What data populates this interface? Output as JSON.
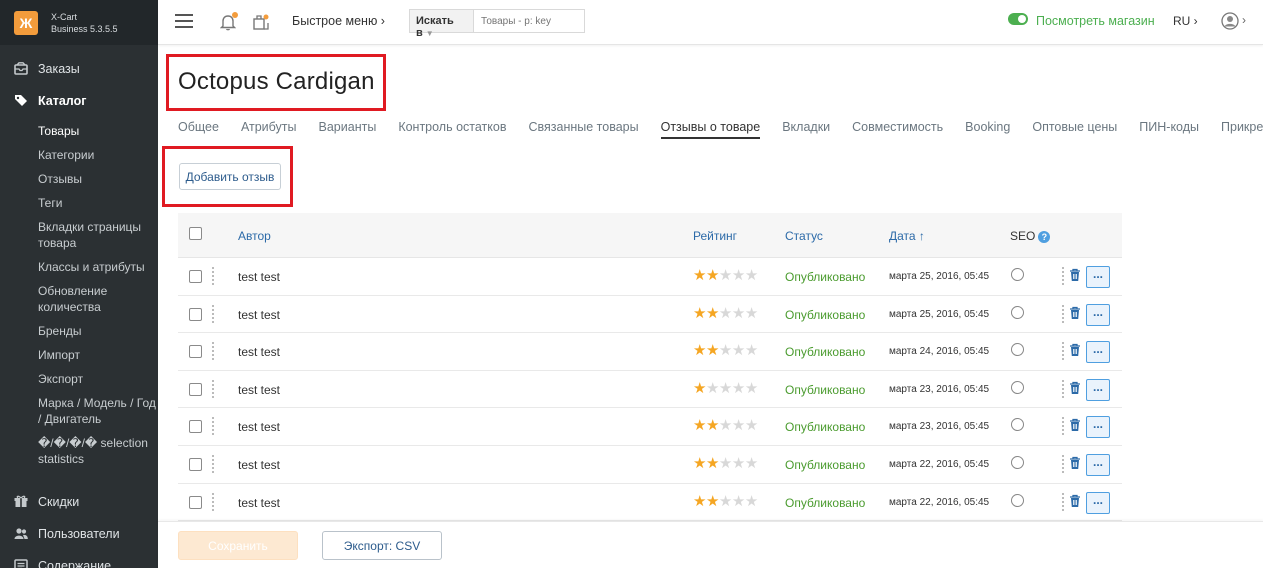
{
  "brand": {
    "line1": "X-Cart",
    "line2": "Business 5.3.5.5",
    "logo_glyph": "Ж"
  },
  "sidebar": {
    "sections": [
      {
        "label": "Заказы",
        "icon": "orders-icon"
      },
      {
        "label": "Каталог",
        "icon": "tag-icon"
      }
    ],
    "catalog_items": [
      "Товары",
      "Категории",
      "Отзывы",
      "Теги",
      "Вкладки страницы товара",
      "Классы и атрибуты",
      "Обновление количества",
      "Бренды",
      "Импорт",
      "Экспорт",
      "Марка / Модель / Год / Двигатель",
      "�/�/�/� selection statistics"
    ],
    "bottom_sections": [
      {
        "label": "Скидки",
        "icon": "gift-icon"
      },
      {
        "label": "Пользователи",
        "icon": "users-icon"
      },
      {
        "label": "Содержание",
        "icon": "content-icon"
      }
    ]
  },
  "header": {
    "quick_menu": "Быстрое меню ›",
    "search_select": "Искать в",
    "search_placeholder": "Товары - p: key",
    "view_store": "Посмотреть магазин",
    "language": "RU ›",
    "user_caret": "›"
  },
  "page": {
    "title": "Octopus Cardigan",
    "tabs": [
      "Общее",
      "Атрибуты",
      "Варианты",
      "Контроль остатков",
      "Связанные товары",
      "Отзывы о товаре",
      "Вкладки",
      "Совместимость",
      "Booking",
      "Оптовые цены",
      "ПИН-коды",
      "Прикрепляемы"
    ],
    "active_tab": "Отзывы о товаре",
    "add_review": "Добавить отзыв"
  },
  "table": {
    "columns": {
      "author": "Автор",
      "rating": "Рейтинг",
      "status": "Статус",
      "date": "Дата ↑",
      "seo": "SEO"
    },
    "rows": [
      {
        "author": "test test",
        "rating": 2,
        "status": "Опубликовано",
        "date": "марта 25, 2016, 05:45"
      },
      {
        "author": "test test",
        "rating": 2,
        "status": "Опубликовано",
        "date": "марта 25, 2016, 05:45"
      },
      {
        "author": "test test",
        "rating": 2,
        "status": "Опубликовано",
        "date": "марта 24, 2016, 05:45"
      },
      {
        "author": "test test",
        "rating": 1,
        "status": "Опубликовано",
        "date": "марта 23, 2016, 05:45"
      },
      {
        "author": "test test",
        "rating": 2,
        "status": "Опубликовано",
        "date": "марта 23, 2016, 05:45"
      },
      {
        "author": "test test",
        "rating": 2,
        "status": "Опубликовано",
        "date": "марта 22, 2016, 05:45"
      },
      {
        "author": "test test",
        "rating": 2,
        "status": "Опубликовано",
        "date": "марта 22, 2016, 05:45"
      }
    ],
    "more_label": "..."
  },
  "footer": {
    "save": "Сохранить",
    "export": "Экспорт: CSV"
  },
  "colors": {
    "accent": "#f39c3c",
    "link": "#2c6aa8",
    "published": "#4a9b2e",
    "highlight": "#e01a22",
    "sidebar": "#2b3033"
  }
}
